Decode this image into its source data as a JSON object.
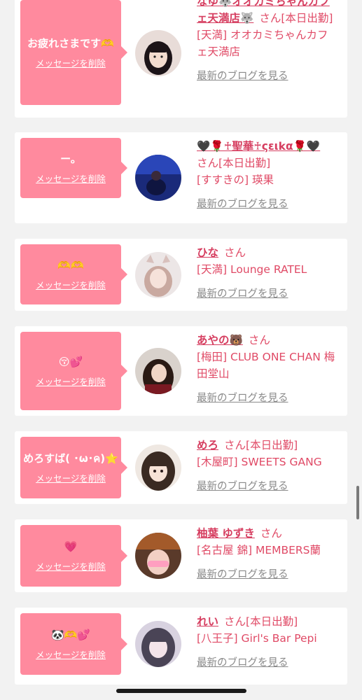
{
  "delete_label": "メッセージを削除",
  "blog_label": "最新のブログを見る",
  "san_label": "さん",
  "accent_color": "#ff8a9e",
  "items": [
    {
      "message": "お疲れさまです🫶",
      "name": "なゆ🐺オオカミちゃんカフェ天満店🐺",
      "status": "[本日出勤]",
      "shop": "[天満] オオカミちゃんカフェ天満店"
    },
    {
      "message": "ー。",
      "name": "🖤🌹♰聖華♰ςειkα🌹🖤",
      "status": "[本日出勤]",
      "shop": "[すすきの] 瑛果"
    },
    {
      "message": "🫶🫶",
      "name": "ひな",
      "status": "",
      "shop": "[天満] Lounge RATEL"
    },
    {
      "message": "😚💕",
      "name": "あやの🐻",
      "status": "",
      "shop": "[梅田] CLUB ONE CHAN 梅田堂山"
    },
    {
      "message": "めろすば( ･ω･ค)⭐️",
      "name": "めろ",
      "status": "[本日出勤]",
      "shop": "[木屋町] SWEETS GANG"
    },
    {
      "message": "💗",
      "name": "柚葉 ゆずき",
      "status": "",
      "shop": "[名古屋 錦] MEMBERS蘭"
    },
    {
      "message": "🐼🫶💕",
      "name": "れい",
      "status": "[本日出勤]",
      "shop": "[八王子] Girl's Bar Pepi"
    }
  ]
}
